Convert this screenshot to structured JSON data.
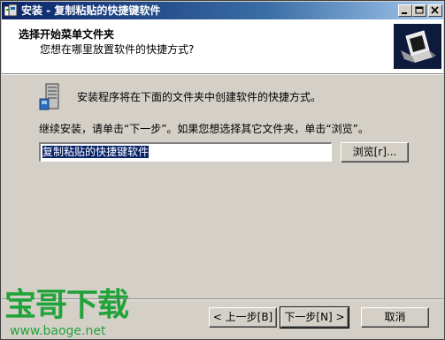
{
  "window": {
    "title": "安装 - 复制粘贴的快捷键软件",
    "app_icon": "setup-app-icon"
  },
  "header": {
    "title": "选择开始菜单文件夹",
    "subtitle": "您想在哪里放置软件的快捷方式?",
    "logo_icon": "computer-box-icon"
  },
  "main": {
    "intro_text": "安装程序将在下面的文件夹中创建软件的快捷方式。",
    "continue_text": "继续安装，请单击“下一步”。如果您想选择其它文件夹，单击“浏览”。",
    "folder_value": "复制粘贴的快捷键软件",
    "browse_label": "浏览[r]..."
  },
  "footer": {
    "back_label": "< 上一步[B]",
    "next_label": "下一步[N] >",
    "cancel_label": "取消"
  },
  "watermark": {
    "brand": "宝哥下载",
    "url": "www.baoge.net"
  },
  "colors": {
    "titlebar_start": "#0a246a",
    "titlebar_end": "#a6caf0",
    "watermark": "#22a33a",
    "dialog_bg": "#d4d0c8"
  }
}
